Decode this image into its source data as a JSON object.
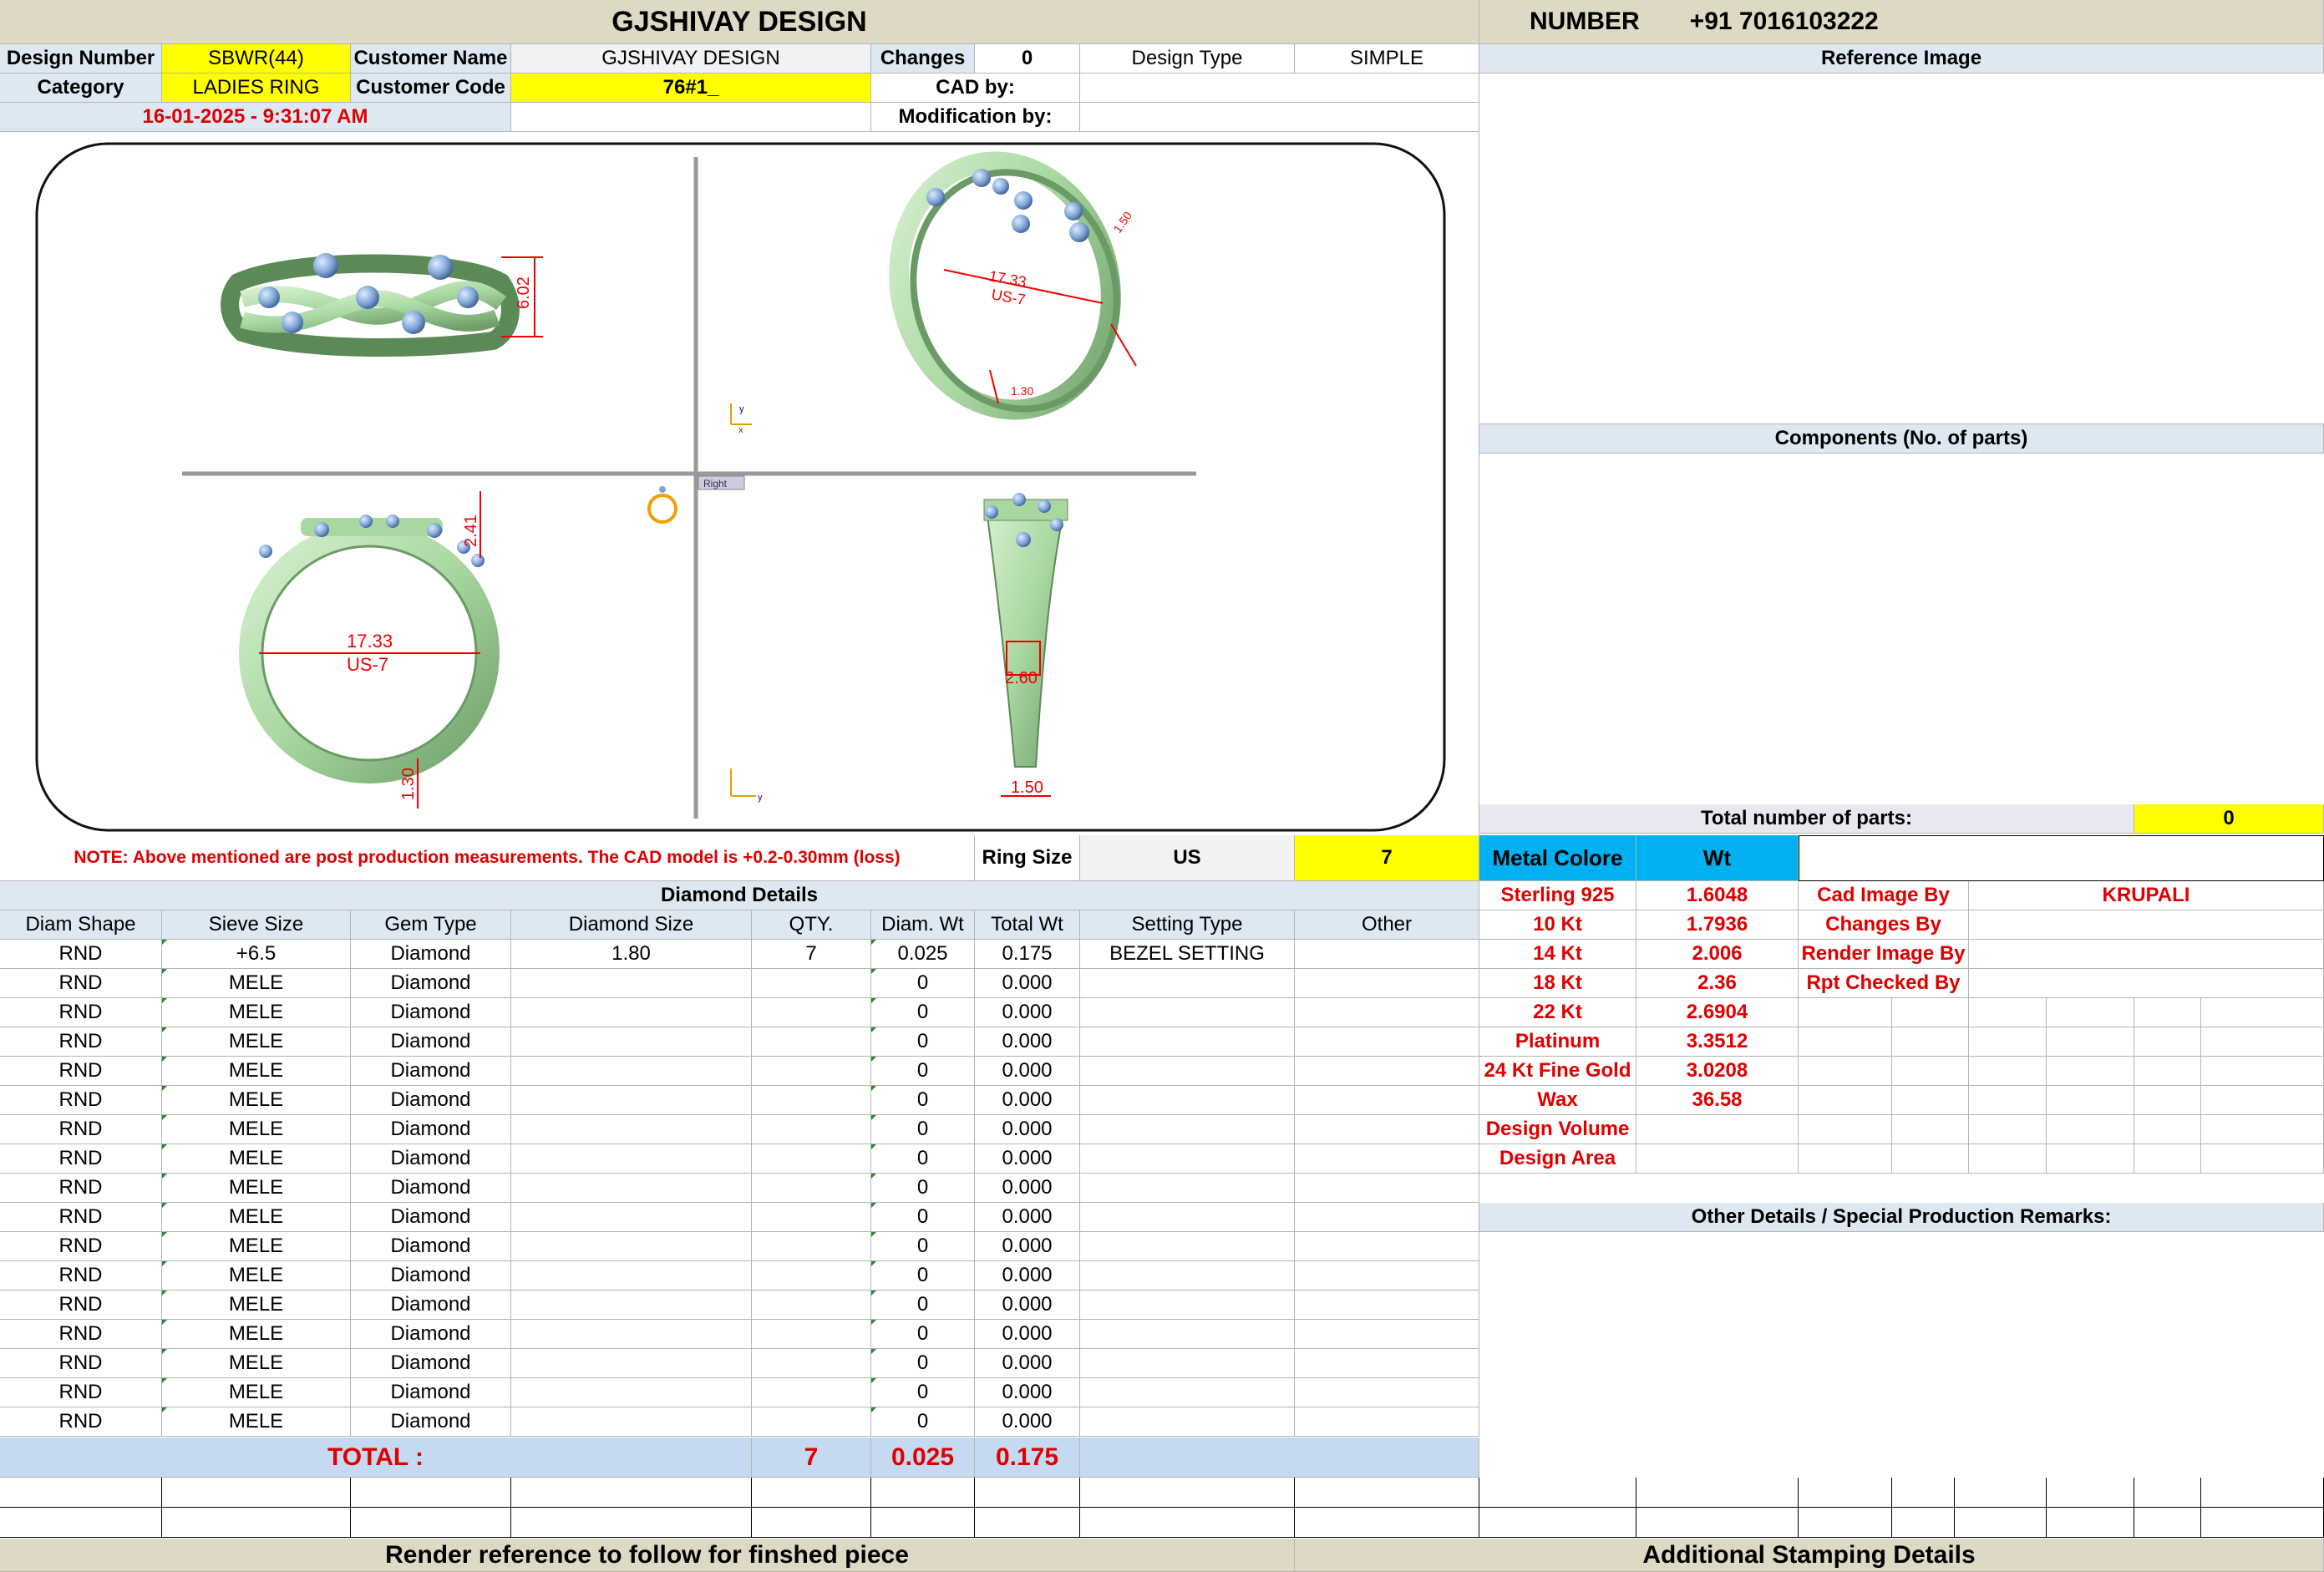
{
  "header": {
    "title": "GJSHIVAY DESIGN",
    "number_label": "NUMBER",
    "number_value": "+91 7016103222"
  },
  "info": {
    "design_number_label": "Design Number",
    "design_number": "SBWR(44)",
    "customer_name_label": "Customer Name",
    "customer_name": "GJSHIVAY DESIGN",
    "changes_label": "Changes",
    "changes": "0",
    "design_type_label": "Design Type",
    "design_type": "SIMPLE",
    "category_label": "Category",
    "category": "LADIES RING",
    "customer_code_label": "Customer Code",
    "customer_code": "76#1_",
    "cad_by_label": "CAD by:",
    "cad_by": "",
    "datetime": "16-01-2025 - 9:31:07 AM",
    "modification_by_label": "Modification by:",
    "modification_by": ""
  },
  "cad_image": {
    "dim_height": "6.02",
    "dim_width": "1.50",
    "dim_shank_top": "2.41",
    "dim_diameter": "17.33",
    "dim_size": "US-7",
    "dim_shank_bottom": "1.30",
    "dim_side": "2.60",
    "dim_iso_small": "1.50",
    "dim_iso_bottom": "1.30",
    "view_label": "Right"
  },
  "note": {
    "text": "NOTE: Above mentioned are post production measurements. The CAD model is +0.2-0.30mm (loss)",
    "ring_size_label": "Ring Size",
    "ring_size_unit": "US",
    "ring_size": "7"
  },
  "diamond": {
    "section_title": "Diamond Details",
    "columns": [
      "Diam Shape",
      "Sieve Size",
      "Gem Type",
      "Diamond Size",
      "QTY.",
      "Diam. Wt",
      "Total Wt",
      "Setting Type",
      "Other"
    ],
    "rows": [
      [
        "RND",
        "+6.5",
        "Diamond",
        "1.80",
        "7",
        "0.025",
        "0.175",
        "BEZEL SETTING",
        ""
      ],
      [
        "RND",
        "MELE",
        "Diamond",
        "",
        "",
        "0",
        "0.000",
        "",
        ""
      ],
      [
        "RND",
        "MELE",
        "Diamond",
        "",
        "",
        "0",
        "0.000",
        "",
        ""
      ],
      [
        "RND",
        "MELE",
        "Diamond",
        "",
        "",
        "0",
        "0.000",
        "",
        ""
      ],
      [
        "RND",
        "MELE",
        "Diamond",
        "",
        "",
        "0",
        "0.000",
        "",
        ""
      ],
      [
        "RND",
        "MELE",
        "Diamond",
        "",
        "",
        "0",
        "0.000",
        "",
        ""
      ],
      [
        "RND",
        "MELE",
        "Diamond",
        "",
        "",
        "0",
        "0.000",
        "",
        ""
      ],
      [
        "RND",
        "MELE",
        "Diamond",
        "",
        "",
        "0",
        "0.000",
        "",
        ""
      ],
      [
        "RND",
        "MELE",
        "Diamond",
        "",
        "",
        "0",
        "0.000",
        "",
        ""
      ],
      [
        "RND",
        "MELE",
        "Diamond",
        "",
        "",
        "0",
        "0.000",
        "",
        ""
      ],
      [
        "RND",
        "MELE",
        "Diamond",
        "",
        "",
        "0",
        "0.000",
        "",
        ""
      ],
      [
        "RND",
        "MELE",
        "Diamond",
        "",
        "",
        "0",
        "0.000",
        "",
        ""
      ],
      [
        "RND",
        "MELE",
        "Diamond",
        "",
        "",
        "0",
        "0.000",
        "",
        ""
      ],
      [
        "RND",
        "MELE",
        "Diamond",
        "",
        "",
        "0",
        "0.000",
        "",
        ""
      ],
      [
        "RND",
        "MELE",
        "Diamond",
        "",
        "",
        "0",
        "0.000",
        "",
        ""
      ],
      [
        "RND",
        "MELE",
        "Diamond",
        "",
        "",
        "0",
        "0.000",
        "",
        ""
      ],
      [
        "RND",
        "MELE",
        "Diamond",
        "",
        "",
        "0",
        "0.000",
        "",
        ""
      ]
    ],
    "total_label": "TOTAL :",
    "total_qty": "7",
    "total_diam_wt": "0.025",
    "total_wt": "0.175"
  },
  "footer": {
    "render_ref": "Render reference to follow for finshed piece",
    "stamping": "Additional Stamping Details"
  },
  "right": {
    "reference_image": "Reference Image",
    "components": "Components (No. of parts)",
    "total_parts_label": "Total number of parts:",
    "total_parts": "0",
    "metal_colore": "Metal Colore",
    "wt": "Wt",
    "metals": [
      {
        "name": "Sterling 925",
        "wt": "1.6048"
      },
      {
        "name": "10 Kt",
        "wt": "1.7936"
      },
      {
        "name": "14 Kt",
        "wt": "2.006"
      },
      {
        "name": "18 Kt",
        "wt": "2.36"
      },
      {
        "name": "22 Kt",
        "wt": "2.6904"
      },
      {
        "name": "Platinum",
        "wt": "3.3512"
      },
      {
        "name": "24 Kt Fine Gold",
        "wt": "3.0208"
      },
      {
        "name": "Wax",
        "wt": "36.58"
      },
      {
        "name": "Design Volume",
        "wt": ""
      },
      {
        "name": "Design Area",
        "wt": ""
      }
    ],
    "roles": [
      {
        "label": "Cad Image By",
        "value": "KRUPALI"
      },
      {
        "label": "Changes By",
        "value": ""
      },
      {
        "label": "Render Image By",
        "value": ""
      },
      {
        "label": "Rpt Checked By",
        "value": ""
      }
    ],
    "other_details": "Other Details / Special Production Remarks:"
  },
  "colors": {
    "yellow": "#ffff00",
    "header_blue": "#dde8f3",
    "metal_blue": "#00b0f0",
    "red": "#e00000",
    "ring_green": "#b8e0b0",
    "stone_blue": "#7fa6d8"
  }
}
